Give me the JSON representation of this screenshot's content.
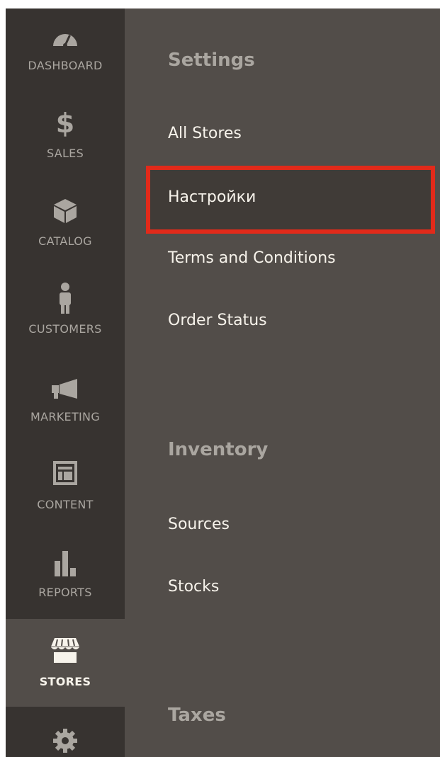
{
  "sidebar": {
    "items": [
      {
        "label": "DASHBOARD",
        "icon": "dashboard-gauge-icon"
      },
      {
        "label": "SALES",
        "icon": "dollar-sign-icon"
      },
      {
        "label": "CATALOG",
        "icon": "box-icon"
      },
      {
        "label": "CUSTOMERS",
        "icon": "person-icon"
      },
      {
        "label": "MARKETING",
        "icon": "megaphone-icon"
      },
      {
        "label": "CONTENT",
        "icon": "layout-icon"
      },
      {
        "label": "REPORTS",
        "icon": "bar-chart-icon"
      },
      {
        "label": "STORES",
        "icon": "storefront-icon",
        "active": true
      },
      {
        "label": "",
        "icon": "gear-icon"
      }
    ]
  },
  "panel": {
    "settings": {
      "title": "Settings",
      "links": [
        "All Stores",
        "Настройки",
        "Terms and Conditions",
        "Order Status"
      ]
    },
    "inventory": {
      "title": "Inventory",
      "links": [
        "Sources",
        "Stocks"
      ]
    },
    "taxes": {
      "title": "Taxes"
    }
  },
  "colors": {
    "sidebar_bg": "#373330",
    "panel_bg": "#524d49",
    "active_bg": "#524d49",
    "highlight_border": "#e22a1a",
    "muted_text": "#aaa6a0",
    "link_text": "#f7f3eb"
  }
}
